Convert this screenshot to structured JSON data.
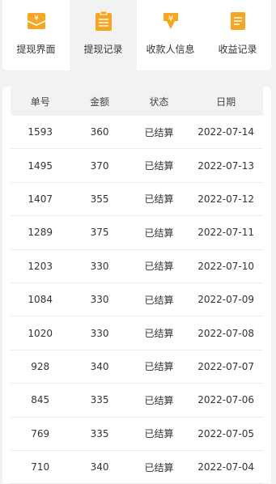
{
  "nav": {
    "items": [
      {
        "label": "提现界面",
        "icon": "wallet-yen-icon",
        "active": false
      },
      {
        "label": "提现记录",
        "icon": "clipboard-list-icon",
        "active": true
      },
      {
        "label": "收款人信息",
        "icon": "yen-download-icon",
        "active": false
      },
      {
        "label": "收益记录",
        "icon": "document-icon",
        "active": false
      }
    ],
    "accent": "#f5a623"
  },
  "table": {
    "headers": [
      "单号",
      "金额",
      "状态",
      "日期"
    ],
    "rows": [
      [
        "1593",
        "360",
        "已结算",
        "2022-07-14"
      ],
      [
        "1495",
        "370",
        "已结算",
        "2022-07-13"
      ],
      [
        "1407",
        "355",
        "已结算",
        "2022-07-12"
      ],
      [
        "1289",
        "375",
        "已结算",
        "2022-07-11"
      ],
      [
        "1203",
        "330",
        "已结算",
        "2022-07-10"
      ],
      [
        "1084",
        "330",
        "已结算",
        "2022-07-09"
      ],
      [
        "1020",
        "330",
        "已结算",
        "2022-07-08"
      ],
      [
        "928",
        "340",
        "已结算",
        "2022-07-07"
      ],
      [
        "845",
        "335",
        "已结算",
        "2022-07-06"
      ],
      [
        "769",
        "335",
        "已结算",
        "2022-07-05"
      ],
      [
        "710",
        "340",
        "已结算",
        "2022-07-04"
      ]
    ]
  }
}
